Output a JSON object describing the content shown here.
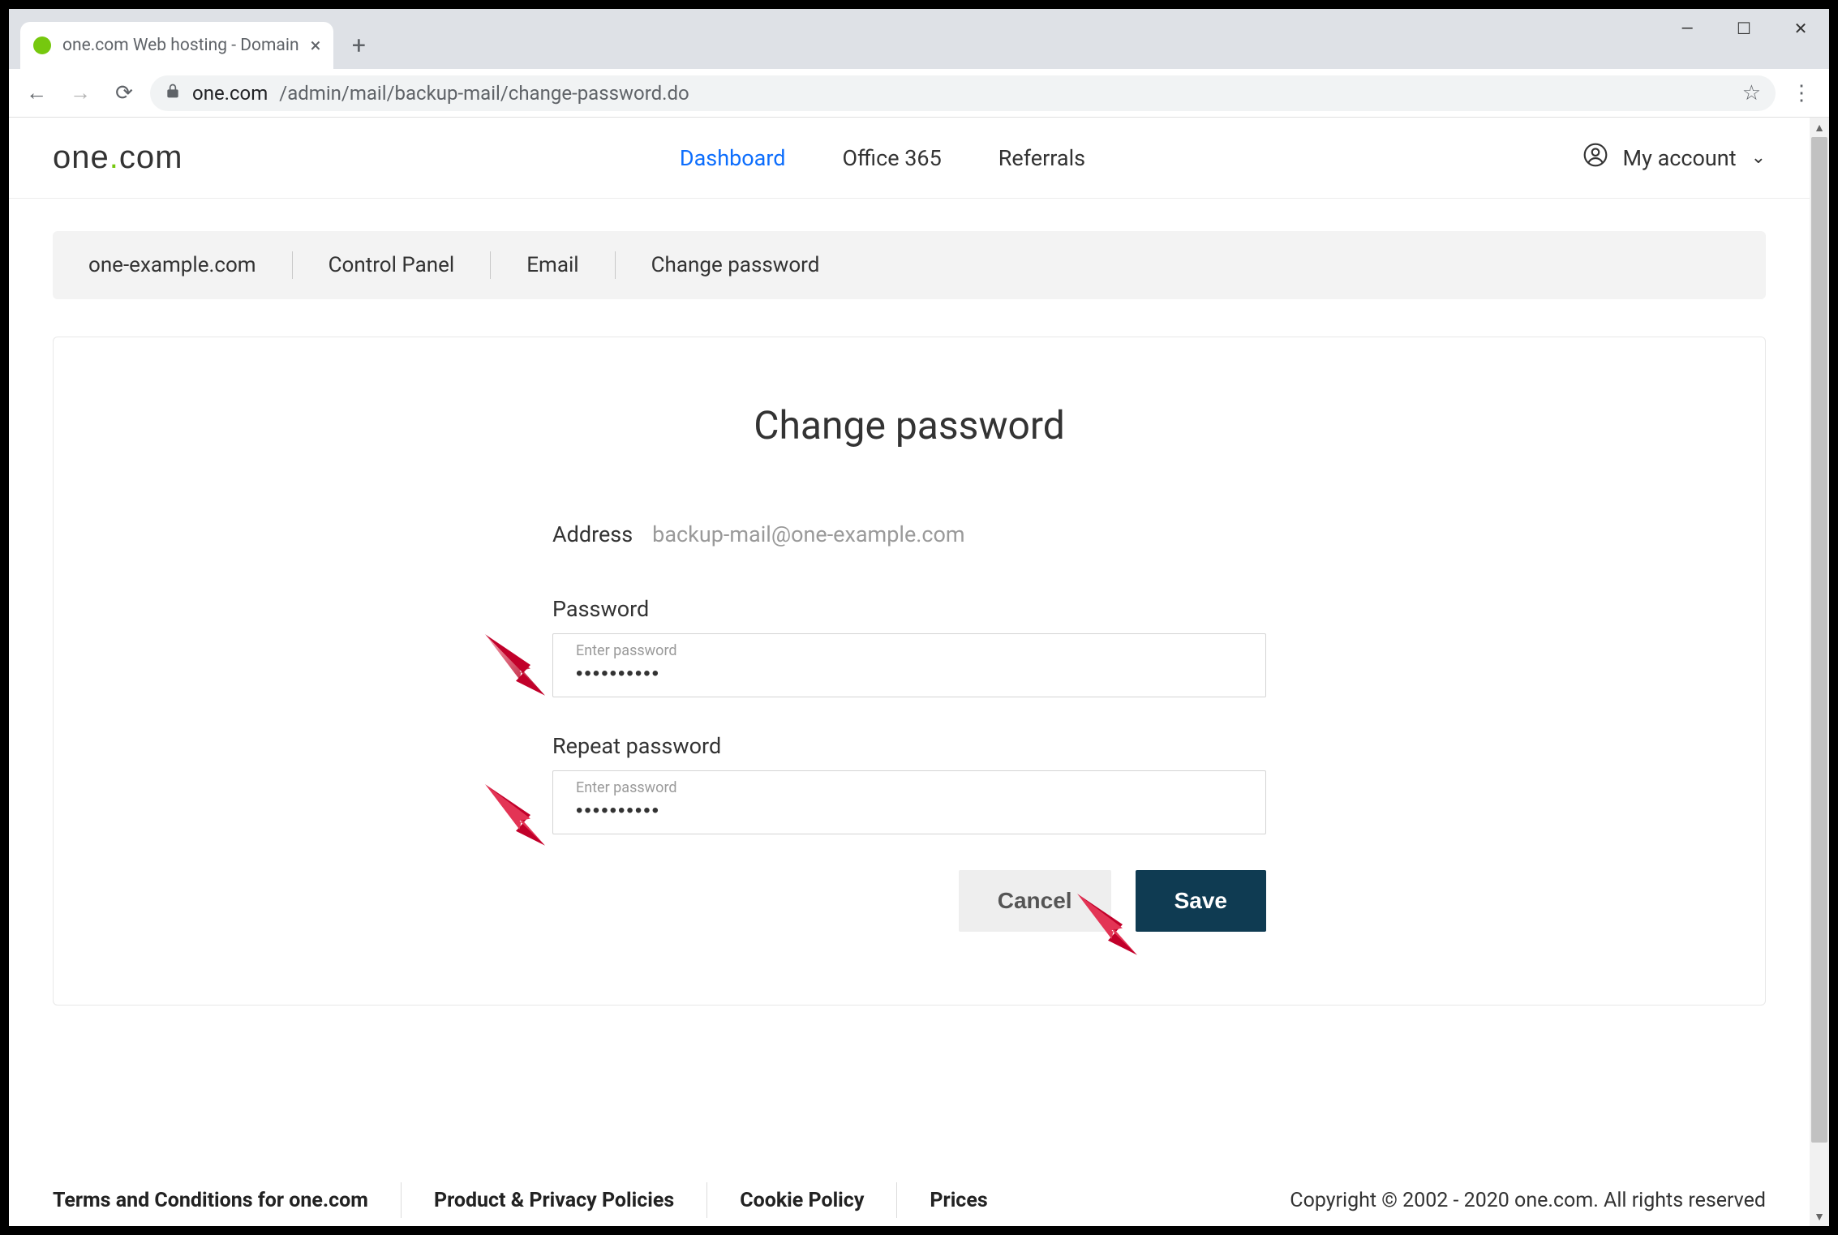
{
  "browser": {
    "tab_title": "one.com Web hosting  -  Domain",
    "url_host": "one.com",
    "url_path": "/admin/mail/backup-mail/change-password.do"
  },
  "header": {
    "logo_text_pre": "one",
    "logo_text_post": "com",
    "nav": {
      "dashboard": "Dashboard",
      "office365": "Office 365",
      "referrals": "Referrals"
    },
    "account_label": "My account"
  },
  "breadcrumb": {
    "domain": "one-example.com",
    "cp": "Control Panel",
    "email": "Email",
    "current": "Change password"
  },
  "form": {
    "title": "Change password",
    "address_label": "Address",
    "address_value": "backup-mail@one-example.com",
    "password_label": "Password",
    "repeat_label": "Repeat password",
    "float_placeholder": "Enter password",
    "password_value": "••••••••••",
    "repeat_value": "••••••••••",
    "cancel": "Cancel",
    "save": "Save"
  },
  "footer": {
    "terms": "Terms and Conditions for one.com",
    "policies": "Product & Privacy Policies",
    "cookie": "Cookie Policy",
    "prices": "Prices",
    "copyright": "Copyright © 2002 - 2020 one.com. All rights reserved"
  }
}
